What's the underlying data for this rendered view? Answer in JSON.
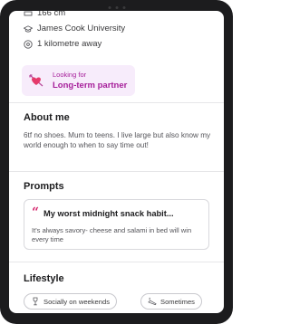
{
  "profile": {
    "height_text": "166 cm",
    "university": "James Cook University",
    "distance": "1 kilometre away"
  },
  "looking_for": {
    "label": "Looking for",
    "value": "Long-term partner",
    "accent": "#a61f9a",
    "icon": "heart-arrow-icon"
  },
  "about": {
    "title": "About me",
    "text": "6tf no shoes. Mum to teens. I live large but also know my world enough to when to say time out!"
  },
  "prompts": {
    "title": "Prompts",
    "items": [
      {
        "quote_mark": "“",
        "question": "My worst midnight snack habit...",
        "answer": "It's always savory- cheese and salami in bed will win every time"
      }
    ]
  },
  "lifestyle": {
    "title": "Lifestyle",
    "chips": [
      {
        "label": "Socially on weekends",
        "icon": "drink-icon"
      },
      {
        "label": "Sometimes",
        "icon": "smoking-icon"
      }
    ]
  },
  "colors": {
    "quote_accent": "#d6286e",
    "card_bg": "#f7ecfb"
  }
}
